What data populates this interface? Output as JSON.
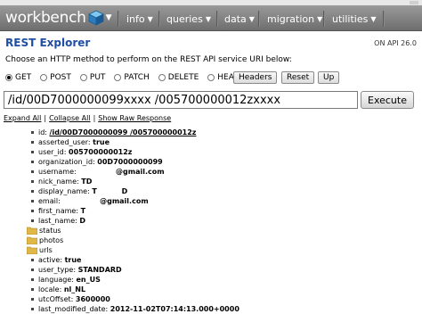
{
  "nav": {
    "logo": "workbench",
    "menus": [
      "info",
      "queries",
      "data",
      "migration",
      "utilities"
    ]
  },
  "header": {
    "title": "REST Explorer",
    "api_version": "ON API 26.0",
    "instructions": "Choose an HTTP method to perform on the REST API service URI below:"
  },
  "methods": {
    "options": [
      "GET",
      "POST",
      "PUT",
      "PATCH",
      "DELETE",
      "HEAD"
    ],
    "selected": "GET",
    "buttons": [
      "Headers",
      "Reset",
      "Up"
    ]
  },
  "uri": {
    "value": "/id/00D7000000099xxxx  /005700000012zxxxx",
    "execute_label": "Execute"
  },
  "links": [
    "Expand All",
    "Collapse All",
    "Show Raw Response"
  ],
  "tree": [
    {
      "key": "id:",
      "value": "/id/00D7000000099        /005700000012z        ",
      "link": true
    },
    {
      "key": "asserted_user:",
      "value": "true"
    },
    {
      "key": "user_id:",
      "value": "005700000012z"
    },
    {
      "key": "organization_id:",
      "value": "00D7000000099"
    },
    {
      "key": "username:",
      "value": "               @gmail.com"
    },
    {
      "key": "nick_name:",
      "value": "TD"
    },
    {
      "key": "display_name:",
      "value": "T          D"
    },
    {
      "key": "email:",
      "value": "               @gmail.com"
    },
    {
      "key": "first_name:",
      "value": "T"
    },
    {
      "key": "last_name:",
      "value": "D"
    },
    {
      "folder": "status"
    },
    {
      "folder": "photos"
    },
    {
      "folder": "urls"
    },
    {
      "key": "active:",
      "value": "true"
    },
    {
      "key": "user_type:",
      "value": "STANDARD"
    },
    {
      "key": "language:",
      "value": "en_US"
    },
    {
      "key": "locale:",
      "value": "nl_NL"
    },
    {
      "key": "utcOffset:",
      "value": "3600000"
    },
    {
      "key": "last_modified_date:",
      "value": "2012-11-02T07:14:13.000+0000"
    }
  ],
  "colors": {
    "title": "#1f4fa0",
    "navbar": "#7e7e7e",
    "folder": "#e0b84a"
  }
}
